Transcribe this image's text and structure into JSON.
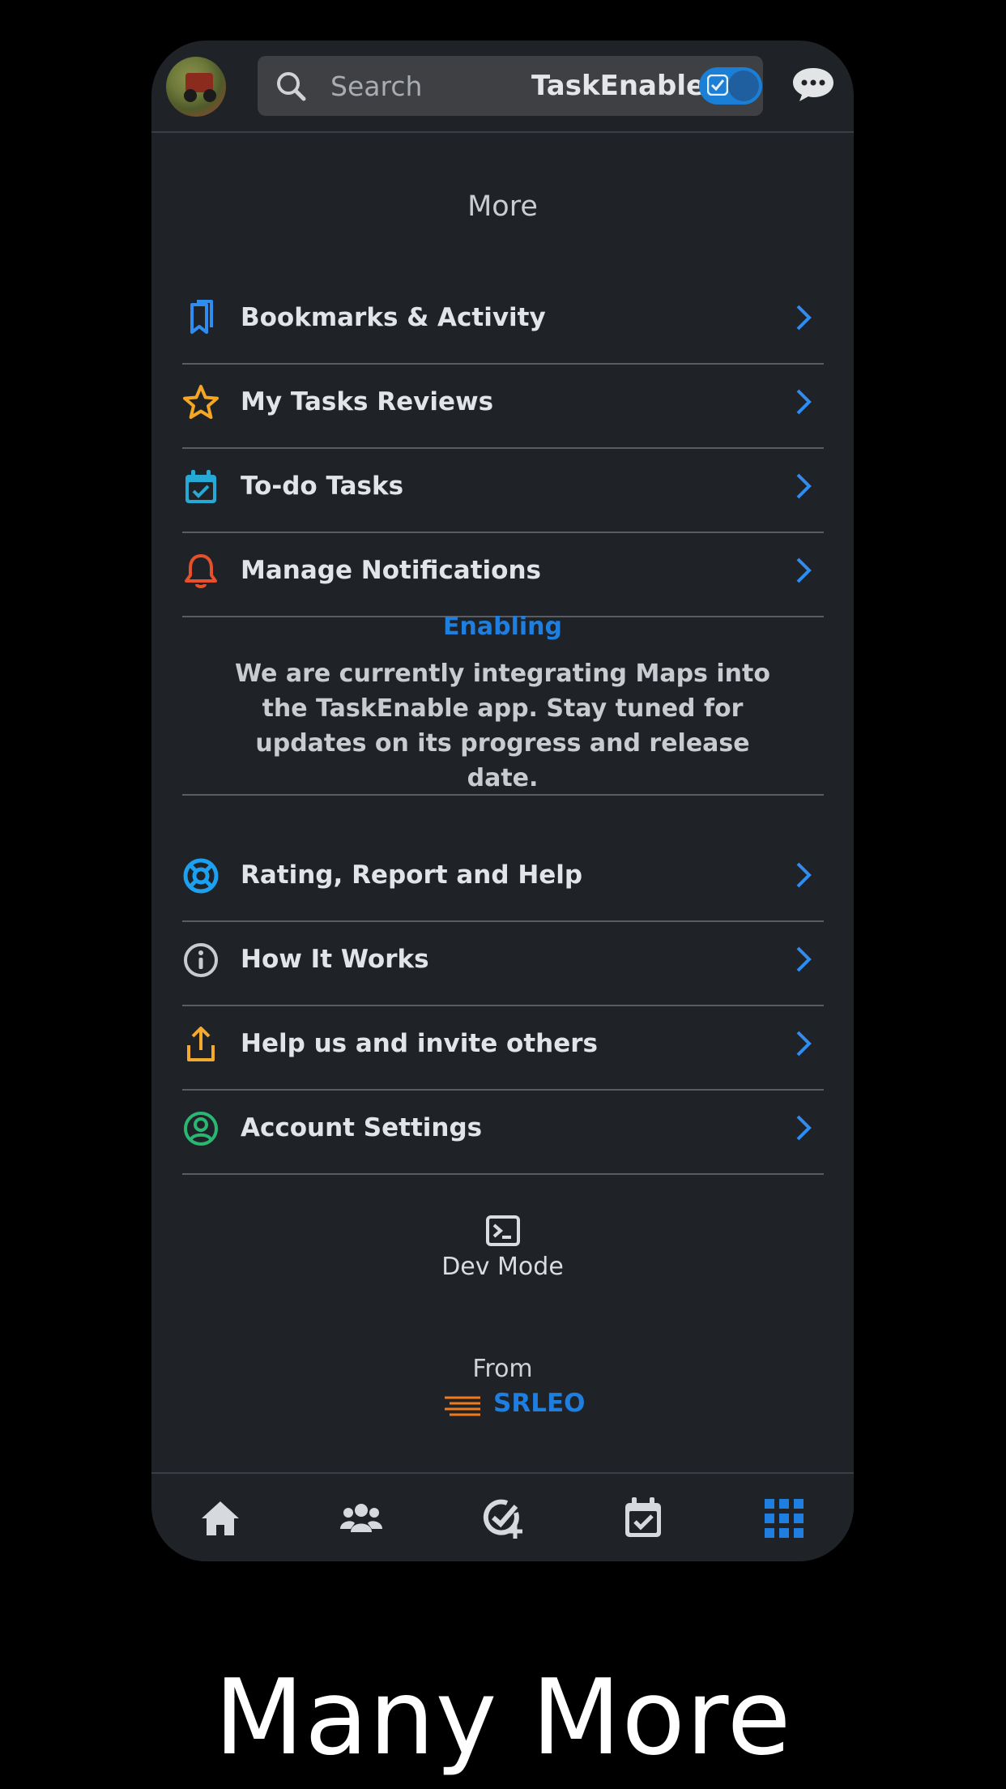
{
  "header": {
    "search_placeholder": "Search",
    "brand": "TaskEnable"
  },
  "page": {
    "title": "More"
  },
  "menu_top": [
    {
      "label": "Bookmarks & Activity",
      "icon": "bookmark-icon",
      "color": "#2f8df2"
    },
    {
      "label": "My Tasks Reviews",
      "icon": "star-icon",
      "color": "#f5a623"
    },
    {
      "label": "To-do Tasks",
      "icon": "calendar-check-icon",
      "color": "#27a9d6"
    },
    {
      "label": "Manage Notifications",
      "icon": "bell-icon",
      "color": "#e8502c"
    }
  ],
  "notice": {
    "title": "Enabling",
    "text": "We are currently integrating Maps into the TaskEnable app. Stay tuned for updates on its progress and release date."
  },
  "menu_bottom": [
    {
      "label": "Rating, Report and Help",
      "icon": "lifebuoy-icon",
      "color": "#1ea0f0"
    },
    {
      "label": "How It Works",
      "icon": "info-icon",
      "color": "#c8ccd1"
    },
    {
      "label": "Help us and invite others",
      "icon": "share-icon",
      "color": "#f2a930"
    },
    {
      "label": "Account Settings",
      "icon": "user-circle-icon",
      "color": "#2ab673"
    }
  ],
  "dev_mode": {
    "label": "Dev Mode"
  },
  "footer": {
    "from": "From",
    "company": "SRLEO"
  },
  "bottom_nav": [
    {
      "icon": "home-icon",
      "active": false
    },
    {
      "icon": "users-icon",
      "active": false
    },
    {
      "icon": "task-add-icon",
      "active": false
    },
    {
      "icon": "calendar-icon",
      "active": false
    },
    {
      "icon": "grid-icon",
      "active": true
    }
  ],
  "caption": "Many More",
  "colors": {
    "accent": "#1e7fe0",
    "background": "#1f2226",
    "chevron": "#2f8df2"
  }
}
